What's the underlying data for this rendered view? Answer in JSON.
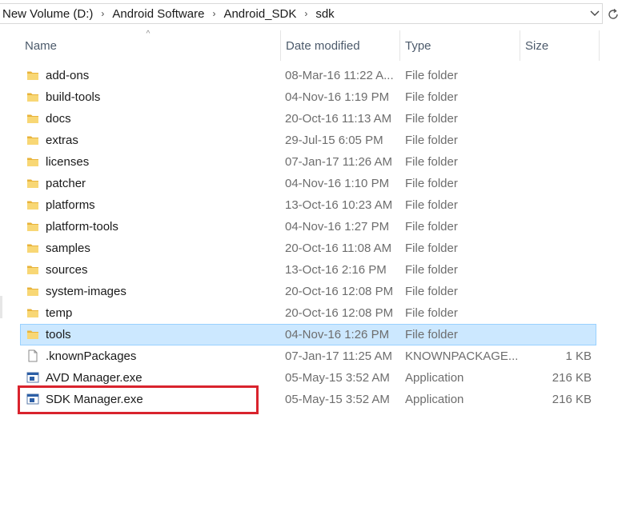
{
  "address_bar": {
    "crumbs": [
      "New Volume (D:)",
      "Android Software",
      "Android_SDK",
      "sdk"
    ],
    "separator": "›"
  },
  "columns": {
    "name": "Name",
    "date": "Date modified",
    "type": "Type",
    "size": "Size"
  },
  "sort_arrow": "^",
  "rows": [
    {
      "name": "add-ons",
      "date": "08-Mar-16 11:22 A...",
      "type": "File folder",
      "size": "",
      "icon": "folder-icon"
    },
    {
      "name": "build-tools",
      "date": "04-Nov-16 1:19 PM",
      "type": "File folder",
      "size": "",
      "icon": "folder-icon"
    },
    {
      "name": "docs",
      "date": "20-Oct-16 11:13 AM",
      "type": "File folder",
      "size": "",
      "icon": "folder-icon"
    },
    {
      "name": "extras",
      "date": "29-Jul-15 6:05 PM",
      "type": "File folder",
      "size": "",
      "icon": "folder-icon"
    },
    {
      "name": "licenses",
      "date": "07-Jan-17 11:26 AM",
      "type": "File folder",
      "size": "",
      "icon": "folder-icon"
    },
    {
      "name": "patcher",
      "date": "04-Nov-16 1:10 PM",
      "type": "File folder",
      "size": "",
      "icon": "folder-icon"
    },
    {
      "name": "platforms",
      "date": "13-Oct-16 10:23 AM",
      "type": "File folder",
      "size": "",
      "icon": "folder-icon"
    },
    {
      "name": "platform-tools",
      "date": "04-Nov-16 1:27 PM",
      "type": "File folder",
      "size": "",
      "icon": "folder-icon"
    },
    {
      "name": "samples",
      "date": "20-Oct-16 11:08 AM",
      "type": "File folder",
      "size": "",
      "icon": "folder-icon"
    },
    {
      "name": "sources",
      "date": "13-Oct-16 2:16 PM",
      "type": "File folder",
      "size": "",
      "icon": "folder-icon"
    },
    {
      "name": "system-images",
      "date": "20-Oct-16 12:08 PM",
      "type": "File folder",
      "size": "",
      "icon": "folder-icon"
    },
    {
      "name": "temp",
      "date": "20-Oct-16 12:08 PM",
      "type": "File folder",
      "size": "",
      "icon": "folder-icon"
    },
    {
      "name": "tools",
      "date": "04-Nov-16 1:26 PM",
      "type": "File folder",
      "size": "",
      "icon": "folder-icon",
      "selected": true
    },
    {
      "name": ".knownPackages",
      "date": "07-Jan-17 11:25 AM",
      "type": "KNOWNPACKAGE...",
      "size": "1 KB",
      "icon": "file-icon"
    },
    {
      "name": "AVD Manager.exe",
      "date": "05-May-15 3:52 AM",
      "type": "Application",
      "size": "216 KB",
      "icon": "app-icon"
    },
    {
      "name": "SDK Manager.exe",
      "date": "05-May-15 3:52 AM",
      "type": "Application",
      "size": "216 KB",
      "icon": "app-icon"
    }
  ],
  "colors": {
    "selection_bg": "#cce8ff",
    "highlight_border": "#d9232d",
    "folder_yellow": "#f4c542"
  }
}
